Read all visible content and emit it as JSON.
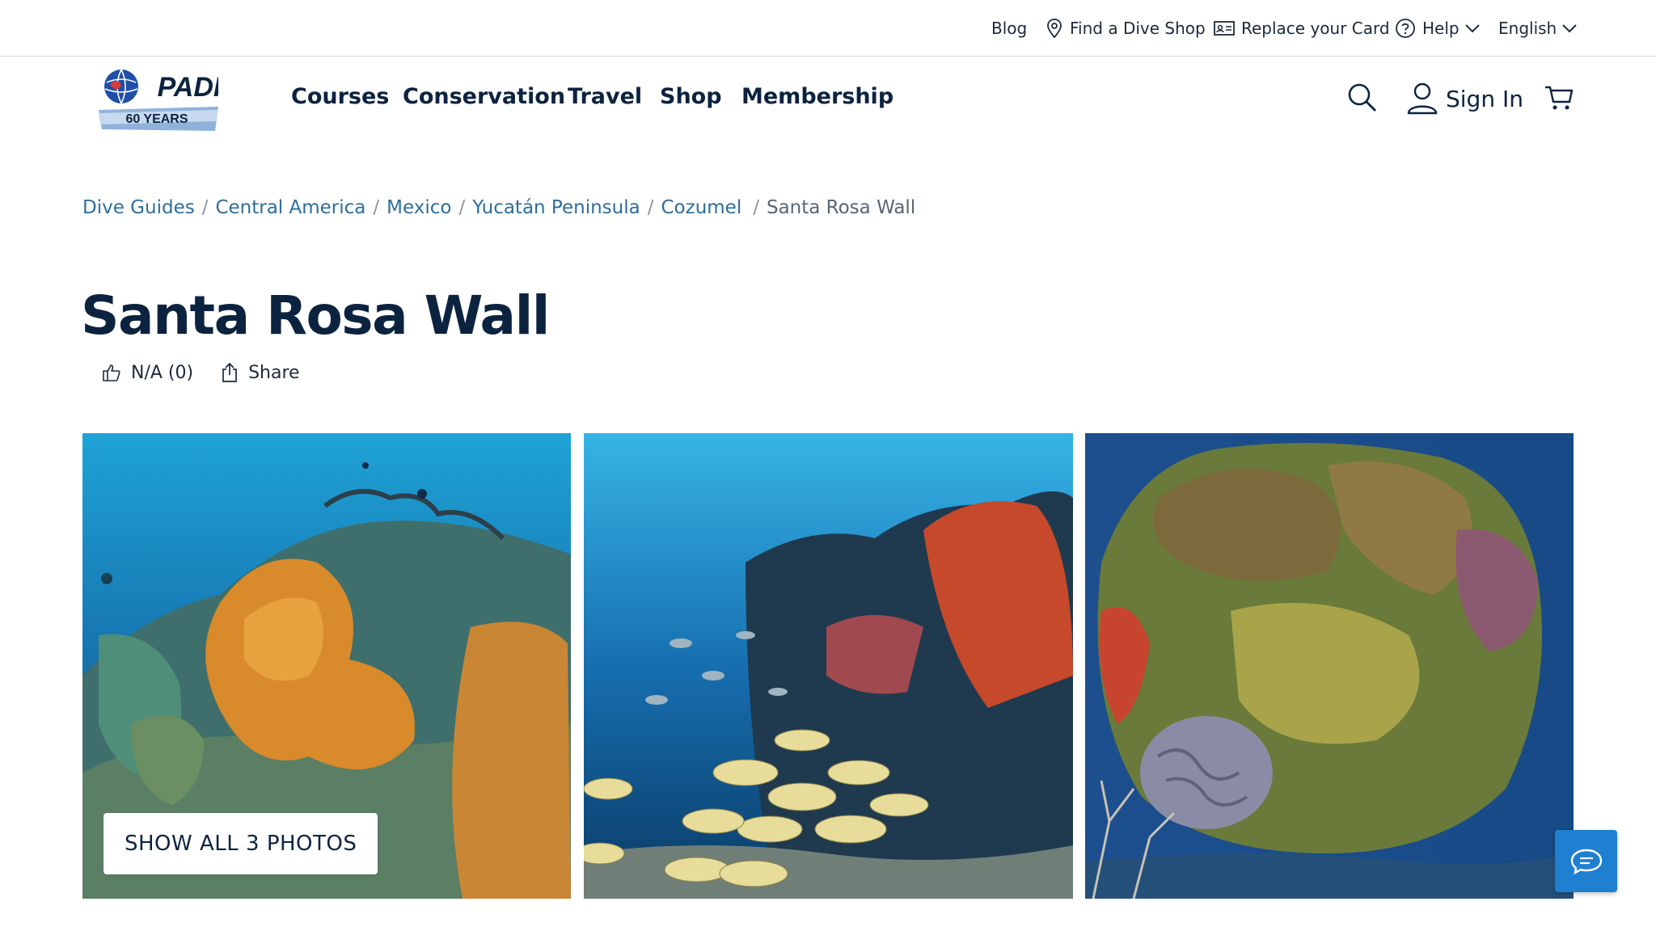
{
  "utility_nav": {
    "blog": "Blog",
    "find_dive_shop": "Find a Dive Shop",
    "replace_card": "Replace your Card",
    "help": "Help",
    "language": "English"
  },
  "logo": {
    "brand": "PADI",
    "tagline": "60 YEARS"
  },
  "main_nav": {
    "items": [
      {
        "label": "Courses"
      },
      {
        "label": "Conservation"
      },
      {
        "label": "Travel"
      },
      {
        "label": "Shop"
      },
      {
        "label": "Membership"
      }
    ],
    "sign_in": "Sign In"
  },
  "breadcrumb": [
    {
      "label": "Dive Guides"
    },
    {
      "label": "Central America"
    },
    {
      "label": "Mexico"
    },
    {
      "label": "Yucatán Peninsula"
    },
    {
      "label": "Cozumel"
    },
    {
      "label": "Santa Rosa Wall"
    }
  ],
  "page": {
    "title": "Santa Rosa Wall",
    "rating": "N/A (0)",
    "share": "Share"
  },
  "gallery": {
    "show_all_label": "SHOW ALL 3 PHOTOS",
    "photos": [
      {
        "subject": "coral reef with orange sponges"
      },
      {
        "subject": "school of yellow grunts over reef"
      },
      {
        "subject": "coral head with brain coral"
      }
    ]
  },
  "colors": {
    "navy": "#0c2340",
    "link_blue": "#2e6d9c",
    "chat_blue": "#1f7fd1"
  }
}
